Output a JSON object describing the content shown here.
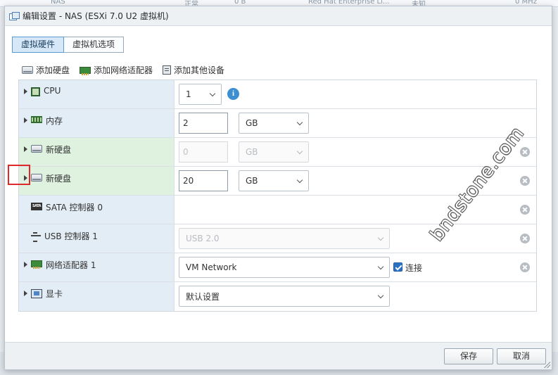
{
  "background": {
    "row_text": [
      "NAS",
      "正常",
      "0 B",
      "Red Hat Enterprise Li...",
      "未知",
      "0 MHz"
    ]
  },
  "dialog": {
    "title": "编辑设置 - NAS (ESXi 7.0 U2 虚拟机)",
    "tabs": [
      {
        "label": "虚拟硬件",
        "active": true
      },
      {
        "label": "虚拟机选项",
        "active": false
      }
    ],
    "toolbar": {
      "add_disk": "添加硬盘",
      "add_network": "添加网络适配器",
      "add_other": "添加其他设备"
    },
    "rows": {
      "cpu": {
        "label": "CPU",
        "value": "1"
      },
      "memory": {
        "label": "内存",
        "value": "2",
        "unit": "GB"
      },
      "disk1": {
        "label": "新硬盘",
        "value": "0",
        "unit": "GB"
      },
      "disk2": {
        "label": "新硬盘",
        "value": "20",
        "unit": "GB"
      },
      "sata": {
        "label": "SATA 控制器 0"
      },
      "usb": {
        "label": "USB 控制器 1",
        "value": "USB 2.0"
      },
      "network": {
        "label": "网络适配器 1",
        "value": "VM Network",
        "connect_label": "连接",
        "connected": true
      },
      "display": {
        "label": "显卡",
        "value": "默认设置"
      }
    },
    "footer": {
      "save": "保存",
      "cancel": "取消"
    }
  },
  "icons": {
    "sata_text": "SATA",
    "info_text": "i"
  },
  "watermark": "bndstone.com",
  "colors": {
    "accent": "#2b73c2",
    "selected_tab": "#d6e8f7",
    "label_cell": "#e3edf5",
    "added_disk_cell": "#dff2df",
    "highlight": "#e02a2a"
  }
}
